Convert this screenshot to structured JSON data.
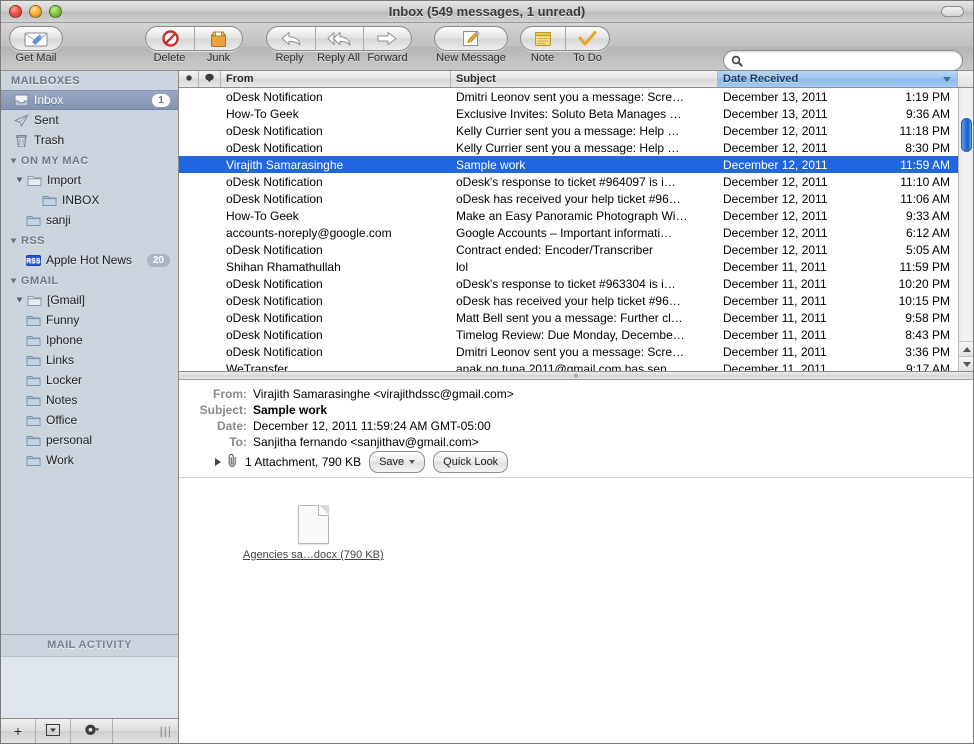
{
  "window": {
    "title": "Inbox (549 messages, 1 unread)",
    "traffic_lights": [
      "close",
      "minimize",
      "zoom"
    ]
  },
  "toolbar": {
    "get_mail": {
      "label": "Get Mail",
      "icon": "envelope-icon"
    },
    "delete": {
      "label": "Delete",
      "icon": "no-entry-icon"
    },
    "junk": {
      "label": "Junk",
      "icon": "junk-bag-icon"
    },
    "reply": {
      "label": "Reply",
      "icon": "reply-arrow-icon"
    },
    "reply_all": {
      "label": "Reply All",
      "icon": "reply-all-arrow-icon"
    },
    "forward": {
      "label": "Forward",
      "icon": "forward-arrow-icon"
    },
    "new_message": {
      "label": "New Message",
      "icon": "compose-icon"
    },
    "note": {
      "label": "Note",
      "icon": "note-icon"
    },
    "todo": {
      "label": "To Do",
      "icon": "checkmark-icon"
    },
    "search": {
      "label": "Search",
      "placeholder": "",
      "value": "",
      "icon": "search-icon"
    }
  },
  "sidebar": {
    "mailboxes_header": "MAILBOXES",
    "mailboxes": [
      {
        "label": "Inbox",
        "icon": "inbox-tray-icon",
        "badge": "1",
        "selected": true,
        "indent": 1
      },
      {
        "label": "Sent",
        "icon": "sent-paper-plane-icon",
        "badge": "",
        "selected": false,
        "indent": 1
      },
      {
        "label": "Trash",
        "icon": "trash-can-icon",
        "badge": "",
        "selected": false,
        "indent": 1
      }
    ],
    "groups": [
      {
        "header": "ON MY MAC",
        "items": [
          {
            "label": "Import",
            "icon": "open-folder-icon",
            "badge": "",
            "indent": 1,
            "disclosure": true
          },
          {
            "label": "INBOX",
            "icon": "folder-icon",
            "badge": "",
            "indent": 3,
            "disclosure": false
          },
          {
            "label": "sanji",
            "icon": "folder-icon",
            "badge": "",
            "indent": 2,
            "disclosure": false
          }
        ]
      },
      {
        "header": "RSS",
        "items": [
          {
            "label": "Apple Hot News",
            "icon": "rss-icon",
            "badge": "20",
            "indent": 2,
            "disclosure": false
          }
        ]
      },
      {
        "header": "GMAIL",
        "items": [
          {
            "label": "[Gmail]",
            "icon": "open-folder-icon",
            "badge": "",
            "indent": 1,
            "disclosure": true
          },
          {
            "label": "Funny",
            "icon": "folder-icon",
            "badge": "",
            "indent": 2,
            "disclosure": false
          },
          {
            "label": "Iphone",
            "icon": "folder-icon",
            "badge": "",
            "indent": 2,
            "disclosure": false
          },
          {
            "label": "Links",
            "icon": "folder-icon",
            "badge": "",
            "indent": 2,
            "disclosure": false
          },
          {
            "label": "Locker",
            "icon": "folder-icon",
            "badge": "",
            "indent": 2,
            "disclosure": false
          },
          {
            "label": "Notes",
            "icon": "folder-icon",
            "badge": "",
            "indent": 2,
            "disclosure": false
          },
          {
            "label": "Office",
            "icon": "folder-icon",
            "badge": "",
            "indent": 2,
            "disclosure": false
          },
          {
            "label": "personal",
            "icon": "folder-icon",
            "badge": "",
            "indent": 2,
            "disclosure": false
          },
          {
            "label": "Work",
            "icon": "folder-icon",
            "badge": "",
            "indent": 2,
            "disclosure": false
          }
        ]
      }
    ],
    "mail_activity_title": "MAIL ACTIVITY",
    "bottom_buttons": [
      {
        "name": "add-mailbox-button",
        "glyph": "+"
      },
      {
        "name": "mail-actions-button",
        "glyph": "▾"
      },
      {
        "name": "settings-gear-button",
        "glyph": "⚙"
      }
    ]
  },
  "message_list": {
    "columns": {
      "unread": "",
      "flag": "",
      "from": "From",
      "subject": "Subject",
      "date": "Date Received"
    },
    "sort_column": "Date Received",
    "sort_direction": "descending",
    "rows": [
      {
        "from": "oDesk Notification",
        "subject": "Dmitri Leonov sent you a message: Scre…",
        "date": "December 13, 2011",
        "time": "1:19 PM",
        "selected": false
      },
      {
        "from": "How-To Geek",
        "subject": "Exclusive Invites: Soluto Beta Manages …",
        "date": "December 13, 2011",
        "time": "9:36 AM",
        "selected": false
      },
      {
        "from": "oDesk Notification",
        "subject": "Kelly Currier sent you a message: Help …",
        "date": "December 12, 2011",
        "time": "11:18 PM",
        "selected": false
      },
      {
        "from": "oDesk Notification",
        "subject": "Kelly Currier sent you a message: Help …",
        "date": "December 12, 2011",
        "time": "8:30 PM",
        "selected": false
      },
      {
        "from": "Virajith Samarasinghe",
        "subject": "Sample work",
        "date": "December 12, 2011",
        "time": "11:59 AM",
        "selected": true
      },
      {
        "from": "oDesk Notification",
        "subject": "oDesk's response to ticket #964097 is i…",
        "date": "December 12, 2011",
        "time": "11:10 AM",
        "selected": false
      },
      {
        "from": "oDesk Notification",
        "subject": "oDesk has received your help ticket #96…",
        "date": "December 12, 2011",
        "time": "11:06 AM",
        "selected": false
      },
      {
        "from": "How-To Geek",
        "subject": "Make an Easy Panoramic Photograph Wi…",
        "date": "December 12, 2011",
        "time": "9:33 AM",
        "selected": false
      },
      {
        "from": "accounts-noreply@google.com",
        "subject": "Google Accounts – Important informati…",
        "date": "December 12, 2011",
        "time": "6:12 AM",
        "selected": false
      },
      {
        "from": "oDesk Notification",
        "subject": "Contract ended: Encoder/Transcriber",
        "date": "December 12, 2011",
        "time": "5:05 AM",
        "selected": false
      },
      {
        "from": "Shihan Rhamathullah",
        "subject": "lol",
        "date": "December 11, 2011",
        "time": "11:59 PM",
        "selected": false
      },
      {
        "from": "oDesk Notification",
        "subject": "oDesk's response to ticket #963304 is i…",
        "date": "December 11, 2011",
        "time": "10:20 PM",
        "selected": false
      },
      {
        "from": "oDesk Notification",
        "subject": "oDesk has received your help ticket #96…",
        "date": "December 11, 2011",
        "time": "10:15 PM",
        "selected": false
      },
      {
        "from": "oDesk Notification",
        "subject": "Matt Bell sent you a message: Further cl…",
        "date": "December 11, 2011",
        "time": "9:58 PM",
        "selected": false
      },
      {
        "from": "oDesk Notification",
        "subject": "Timelog Review: Due Monday, Decembe…",
        "date": "December 11, 2011",
        "time": "8:43 PM",
        "selected": false
      },
      {
        "from": "oDesk Notification",
        "subject": "Dmitri Leonov sent you a message: Scre…",
        "date": "December 11, 2011",
        "time": "3:36 PM",
        "selected": false
      },
      {
        "from": "WeTransfer",
        "subject": "anak.ng.tupa.2011@gmail.com has sen…",
        "date": "December 11, 2011",
        "time": "9:17 AM",
        "selected": false
      }
    ]
  },
  "message_view": {
    "labels": {
      "from": "From:",
      "subject": "Subject:",
      "date": "Date:",
      "to": "To:"
    },
    "from": "Virajith Samarasinghe <virajithdssc@gmail.com>",
    "subject": "Sample work",
    "date": "December 12, 2011 11:59:24 AM GMT-05:00",
    "to": "Sanjitha fernando <sanjithav@gmail.com>",
    "attachment_summary": "1 Attachment, 790 KB",
    "save_button": "Save",
    "quick_look_button": "Quick Look",
    "attachment": {
      "name": "Agencies sa…docx (790 KB)",
      "icon": "document-icon"
    }
  },
  "colors": {
    "selection_blue": "#1f66e0",
    "sidebar_bg": "#ccd4de",
    "sidebar_selected": "#8593b4",
    "sort_header_blue": "#9cc4ee"
  }
}
